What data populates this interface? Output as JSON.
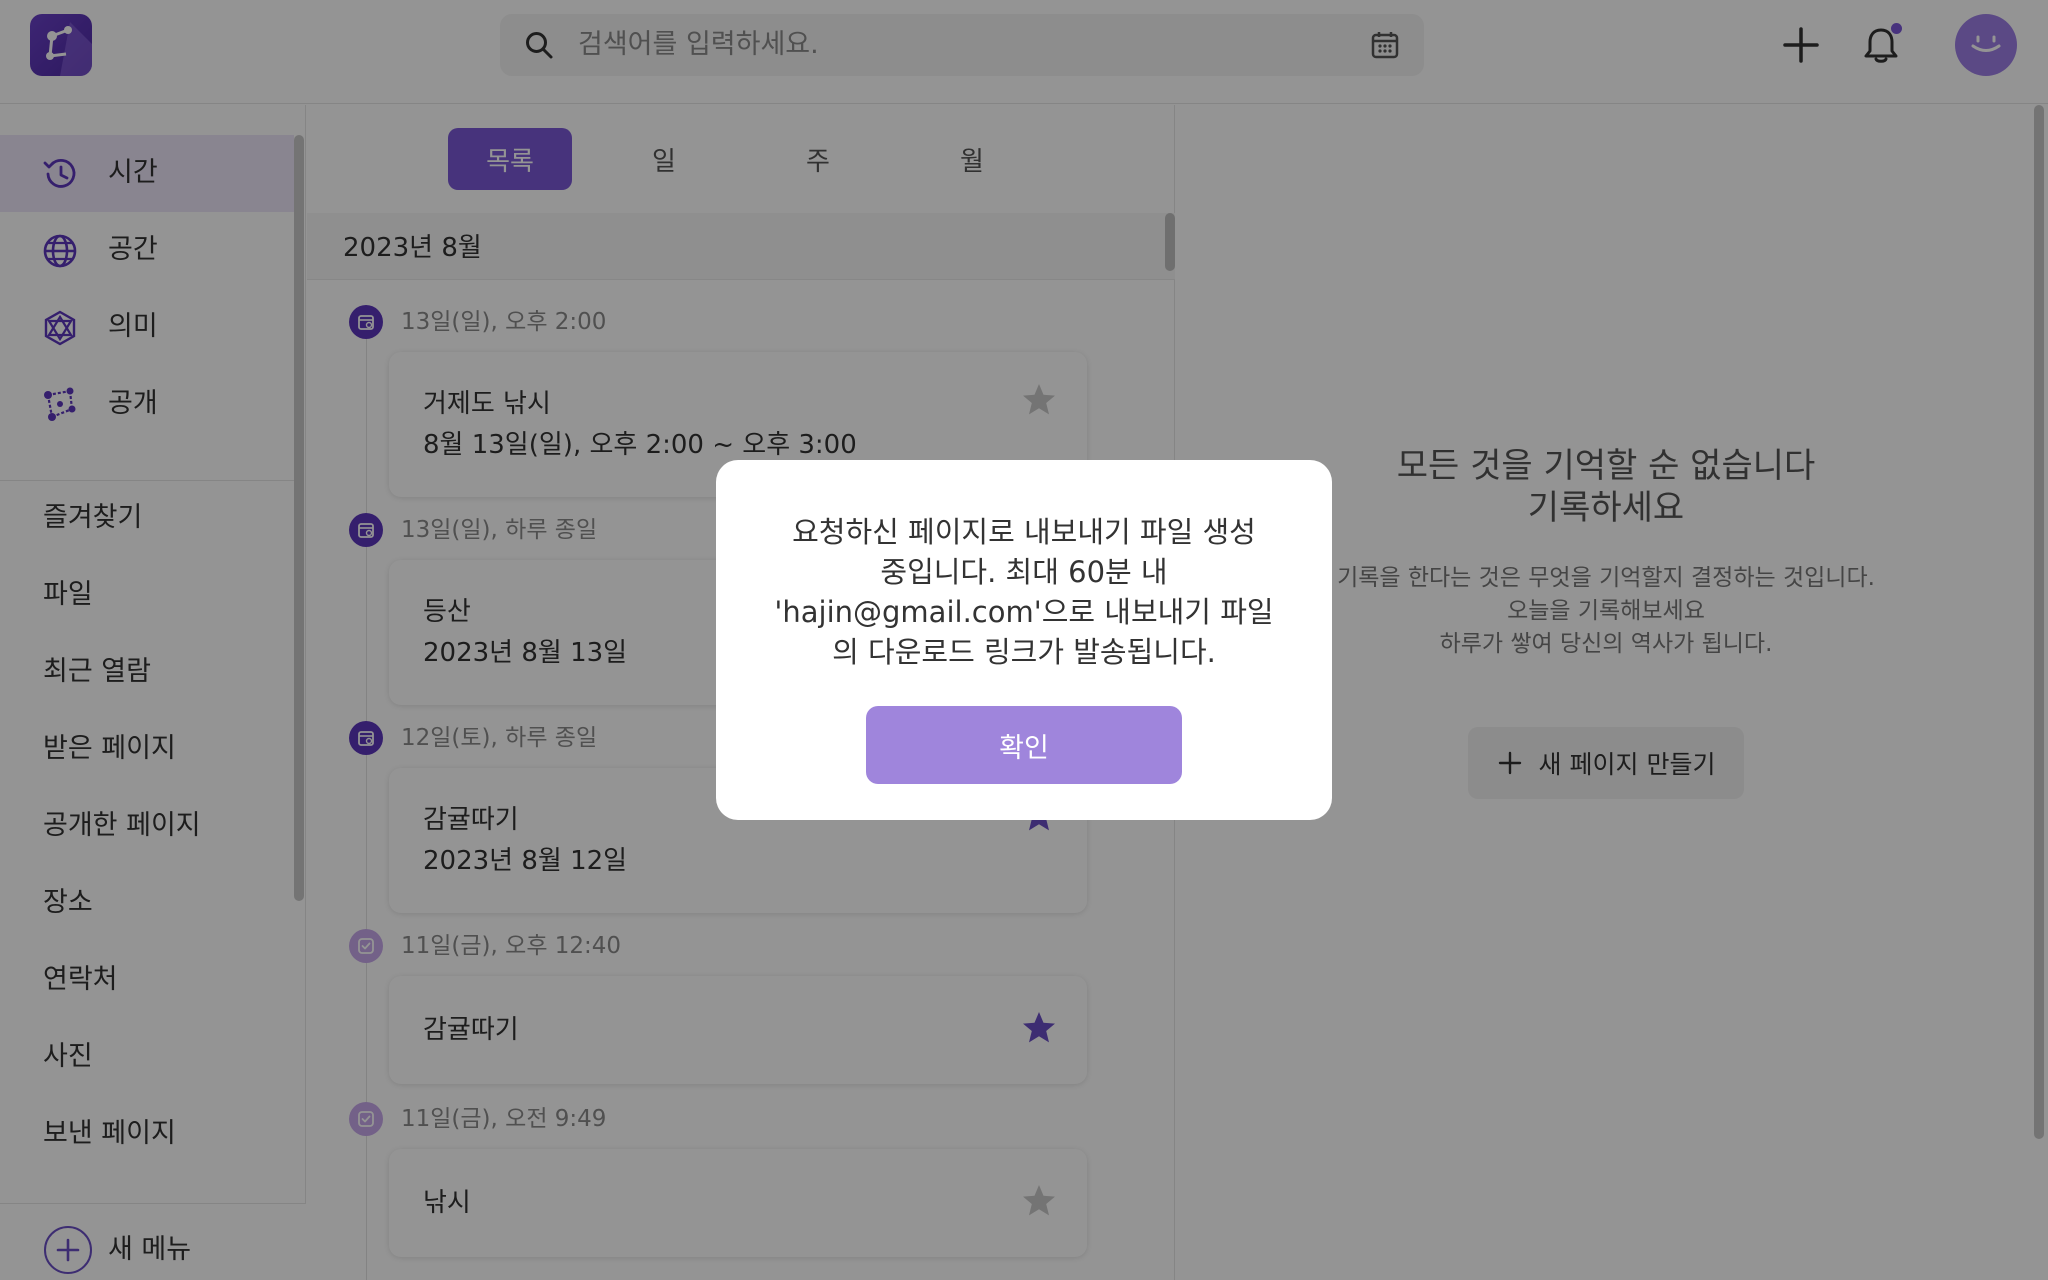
{
  "header": {
    "search_placeholder": "검색어를 입력하세요."
  },
  "sidebar": {
    "main_items": [
      {
        "label": "시간",
        "icon": "history-clock-icon",
        "active": true
      },
      {
        "label": "공간",
        "icon": "globe-icon",
        "active": false
      },
      {
        "label": "의미",
        "icon": "network-star-icon",
        "active": false
      },
      {
        "label": "공개",
        "icon": "share-graph-icon",
        "active": false
      }
    ],
    "links": [
      "즐겨찾기",
      "파일",
      "최근 열람",
      "받은 페이지",
      "공개한 페이지",
      "장소",
      "연락처",
      "사진",
      "보낸 페이지"
    ],
    "new_menu_label": "새 메뉴"
  },
  "view_tabs": {
    "list": "목록",
    "day": "일",
    "week": "주",
    "month": "월"
  },
  "timeline": {
    "month_label": "2023년 8월",
    "entries": [
      {
        "meta": "13일(일), 오후 2:00",
        "title": "거제도 낚시",
        "date": "8월 13일(일), 오후 2:00 ~ 오후 3:00",
        "kind": "event",
        "starred": false
      },
      {
        "meta": "13일(일), 하루 종일",
        "title": "등산",
        "date": "2023년 8월 13일",
        "kind": "event",
        "starred": false
      },
      {
        "meta": "12일(토), 하루 종일",
        "title": "감귤따기",
        "date": "2023년 8월 12일",
        "kind": "event",
        "starred": true
      },
      {
        "meta": "11일(금), 오후 12:40",
        "title": "감귤따기",
        "date": "",
        "kind": "task",
        "starred": true
      },
      {
        "meta": "11일(금), 오전 9:49",
        "title": "낚시",
        "date": "",
        "kind": "task",
        "starred": false
      }
    ]
  },
  "right_panel": {
    "heading_line1": "모든 것을 기억할 순 없습니다",
    "heading_line2": "기록하세요",
    "desc_line1": "기록을 한다는 것은 무엇을 기억할지 결정하는 것입니다.",
    "desc_line2": "오늘을 기록해보세요",
    "desc_line3": "하루가 쌓여 당신의 역사가 됩니다.",
    "new_page_label": "새 페이지 만들기"
  },
  "modal": {
    "line1": "요청하신 페이지로 내보내기 파일 생성",
    "line2": "중입니다. 최대 60분 내",
    "line3": "'hajin@gmail.com'으로 내보내기 파일",
    "line4": "의 다운로드 링크가 발송됩니다.",
    "confirm_label": "확인"
  },
  "colors": {
    "accent": "#7a59d6",
    "accent_dark": "#5c36bc",
    "accent_light": "#c6a7ea",
    "modal_button": "#9f85dc",
    "star_active": "#6a4ec4",
    "star_inactive": "#c8c8c8"
  }
}
